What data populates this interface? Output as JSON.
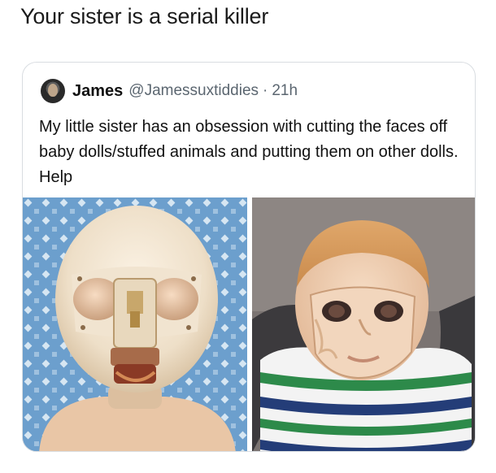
{
  "caption": "Your sister is a serial killer",
  "tweet": {
    "author_name": "James",
    "author_handle": "@Jamessuxtiddies",
    "separator": "·",
    "timestamp": "21h",
    "text": "My little sister has an obsession with cutting the faces off baby dolls/stuffed animals and putting them on other dolls. Help"
  },
  "colors": {
    "border": "#d9dde1",
    "secondary_text": "#5b6670"
  },
  "icons": {
    "avatar": "profile-avatar"
  }
}
